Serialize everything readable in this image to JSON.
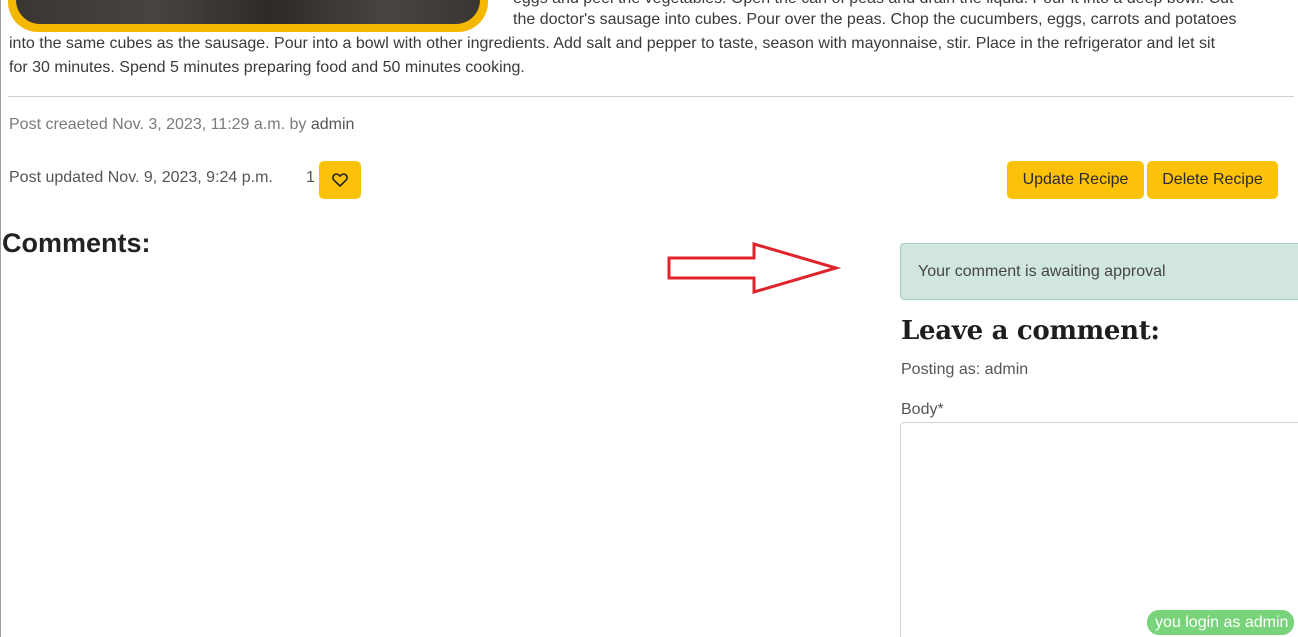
{
  "recipe": {
    "method_lines": [
      "eggs and peel the vegetables. Open the can of peas and drain the liquid. Pour it into a deep bowl. Cut",
      "the doctor's sausage into cubes. Pour over the peas. Chop the cucumbers, eggs, carrots and potatoes",
      "into the same cubes as the sausage. Pour into a bowl with other ingredients. Add salt and pepper to taste, season with mayonnaise, stir. Place in the refrigerator and let sit",
      "for 30 minutes. Spend 5 minutes preparing food and 50 minutes cooking."
    ]
  },
  "post_meta": {
    "created_prefix": "Post creaeted Nov. 3, 2023, 11:29 a.m. by",
    "author": "admin",
    "updated_text": "Post updated Nov. 9, 2023, 9:24 p.m.",
    "like_count": "1"
  },
  "actions": {
    "update_label": "Update Recipe",
    "delete_label": "Delete Recipe"
  },
  "comments": {
    "heading": "Comments:"
  },
  "alert": {
    "message": "Your comment is awaiting approval"
  },
  "comment_form": {
    "heading": "Leave a comment:",
    "posting_as": "Posting as: admin",
    "body_label": "Body*",
    "body_value": ""
  },
  "status": {
    "login_text": "you login as admin"
  },
  "colors": {
    "accent_yellow": "#fcc20a",
    "alert_bg": "#d1e7dd",
    "badge_green": "#79d37a",
    "annotation_arrow": "#e0242b"
  },
  "icons": {
    "like": "heart-outline-icon",
    "annotation": "right-arrow-annotation-icon"
  }
}
